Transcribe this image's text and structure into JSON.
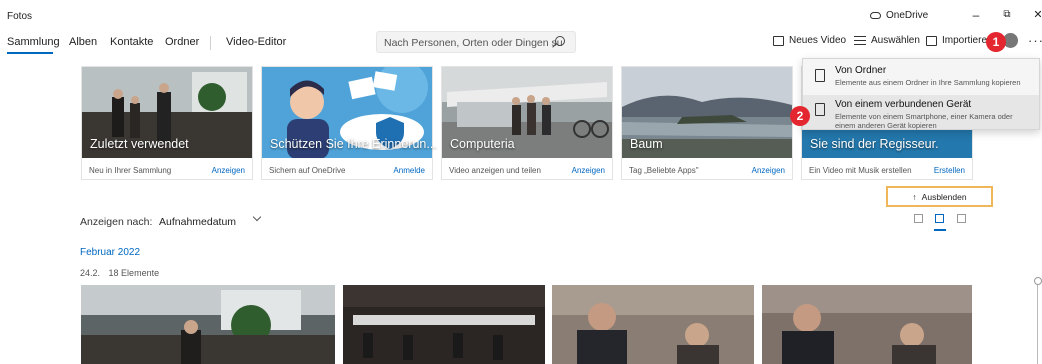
{
  "window": {
    "title": "Fotos",
    "onedrive_label": "OneDrive",
    "minimize": "–",
    "maximize": "⧉",
    "close": "✕"
  },
  "nav": {
    "tabs": [
      "Sammlung",
      "Alben",
      "Kontakte",
      "Ordner"
    ],
    "video_editor": "Video-Editor",
    "search_placeholder": "Nach Personen, Orten oder Dingen su"
  },
  "toolbar": {
    "new_video": "Neues Video",
    "select": "Auswählen",
    "import": "Importieren",
    "more": "···"
  },
  "badges": {
    "one": "1",
    "two": "2"
  },
  "cards": [
    {
      "title": "Zuletzt verwendet",
      "subtitle": "Neu in Ihrer Sammlung",
      "link": "Anzeigen"
    },
    {
      "title": "Schützen Sie Ihre Erinnerun...",
      "subtitle": "Sichern auf OneDrive",
      "link": "Anmelde"
    },
    {
      "title": "Computeria",
      "subtitle": "Video anzeigen und teilen",
      "link": "Anzeigen"
    },
    {
      "title": "Baum",
      "subtitle": "Tag „Beliebte Apps\"",
      "link": "Anzeigen"
    },
    {
      "title": "Sie sind der Regisseur.",
      "subtitle": "Ein Video mit Musik erstellen",
      "link": "Erstellen"
    }
  ],
  "import_menu": {
    "items": [
      {
        "title": "Von Ordner",
        "desc": "Elemente aus einem Ordner in Ihre Sammlung kopieren"
      },
      {
        "title": "Von einem verbundenen Gerät",
        "desc": "Elemente von einem Smartphone, einer Kamera oder einem anderen Gerät kopieren"
      }
    ]
  },
  "hide_button": "Ausblenden",
  "sort": {
    "label": "Anzeigen nach:",
    "value": "Aufnahmedatum"
  },
  "timeline": {
    "month": "Februar 2022",
    "day": "24.2.",
    "count": "18 Elemente"
  },
  "colors": {
    "accent": "#0067c0",
    "badge": "#e3262f",
    "highlight": "#f0b75a"
  }
}
